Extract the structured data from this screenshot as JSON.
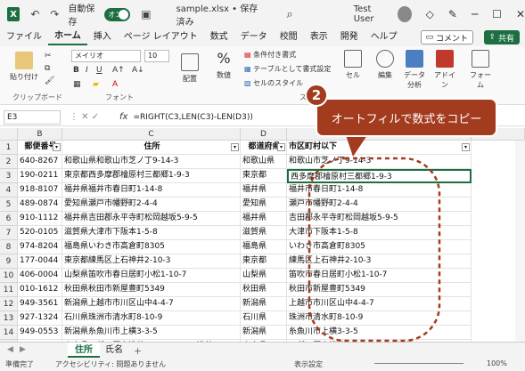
{
  "titlebar": {
    "logo": "X",
    "autosave_label": "自動保存",
    "autosave_state": "オン",
    "doc_title": "sample.xlsx • 保存済み",
    "user": "Test User"
  },
  "menu": {
    "tabs": [
      "ファイル",
      "ホーム",
      "挿入",
      "ページ レイアウト",
      "数式",
      "データ",
      "校閲",
      "表示",
      "開発",
      "ヘルプ"
    ],
    "active_index": 1,
    "comment": "コメント",
    "share": "共有"
  },
  "ribbon": {
    "paste": "貼り付け",
    "clipboard": "クリップボード",
    "font_name": "メイリオ",
    "font_size": "10",
    "font_group": "フォント",
    "align": "配置",
    "number": "数値",
    "number_symbol": "%",
    "cond_format": "条件付き書式",
    "table_format": "テーブルとして書式設定",
    "cell_style": "セルのスタイル",
    "style_group": "スタイル",
    "cell": "セル",
    "edit": "編集",
    "data_analysis": "データ分析",
    "addin": "アドイン",
    "form": "フォーム"
  },
  "formula_bar": {
    "name_box": "E3",
    "fx": "fx",
    "formula": "=RIGHT(C3,LEN(C3)-LEN(D3))"
  },
  "grid": {
    "columns": [
      "B",
      "C",
      "D",
      "E"
    ],
    "row_numbers": [
      "1",
      "2",
      "3",
      "4",
      "5",
      "6",
      "7",
      "8",
      "9",
      "10",
      "11",
      "12",
      "13",
      "14",
      "15",
      "16"
    ],
    "headers": [
      "郵便番号",
      "住所",
      "都道府県",
      "市区町村以下"
    ],
    "rows": [
      [
        "640-8267",
        "和歌山県和歌山市芝ノ丁9-14-3",
        "和歌山県",
        "和歌山市芝ノ丁9-14-3"
      ],
      [
        "190-0211",
        "東京都西多摩郡檜原村三都郷1-9-3",
        "東京都",
        "西多摩郡檜原村三都郷1-9-3"
      ],
      [
        "918-8107",
        "福井県福井市春日町1-14-8",
        "福井県",
        "福井市春日町1-14-8"
      ],
      [
        "489-0874",
        "愛知県瀬戸市幡野町2-4-4",
        "愛知県",
        "瀬戸市幡野町2-4-4"
      ],
      [
        "910-1112",
        "福井県吉田郡永平寺町松岡越坂5-9-5",
        "福井県",
        "吉田郡永平寺町松岡越坂5-9-5"
      ],
      [
        "520-0105",
        "滋賀県大津市下阪本1-5-8",
        "滋賀県",
        "大津市下阪本1-5-8"
      ],
      [
        "974-8204",
        "福島県いわき市高倉町8305",
        "福島県",
        "いわき市高倉町8305"
      ],
      [
        "177-0044",
        "東京都練馬区上石神井2-10-3",
        "東京都",
        "練馬区上石神井2-10-3"
      ],
      [
        "406-0004",
        "山梨県笛吹市春日居町小松1-10-7",
        "山梨県",
        "笛吹市春日居町小松1-10-7"
      ],
      [
        "010-1612",
        "秋田県秋田市新屋豊町5349",
        "秋田県",
        "秋田市新屋豊町5349"
      ],
      [
        "949-3561",
        "新潟県上越市市川区山中4-4-7",
        "新潟県",
        "上越市市川区山中4-4-7"
      ],
      [
        "927-1324",
        "石川県珠洲市清水町8-10-9",
        "石川県",
        "珠洲市清水町8-10-9"
      ],
      [
        "949-0553",
        "新潟県糸魚川市上横3-3-5",
        "新潟県",
        "糸魚川市上横3-3-5"
      ],
      [
        "037-0613",
        "青森県五所川原市浅井9-11-7 シティ浅井 1301",
        "青森県",
        "五所川原市浅井9-11-7 シティ浅井 1301"
      ]
    ]
  },
  "sheets": [
    "住所",
    "氏名"
  ],
  "active_sheet": 0,
  "status": {
    "ready": "準備完了",
    "accessibility": "アクセシビリティ: 問題ありません",
    "display_settings": "表示設定",
    "zoom": "100%"
  },
  "annotation": {
    "step": "2",
    "text": "オートフィルで数式をコピー"
  },
  "colors": {
    "excel_green": "#1d6f42",
    "annotation": "#a33b1f"
  }
}
